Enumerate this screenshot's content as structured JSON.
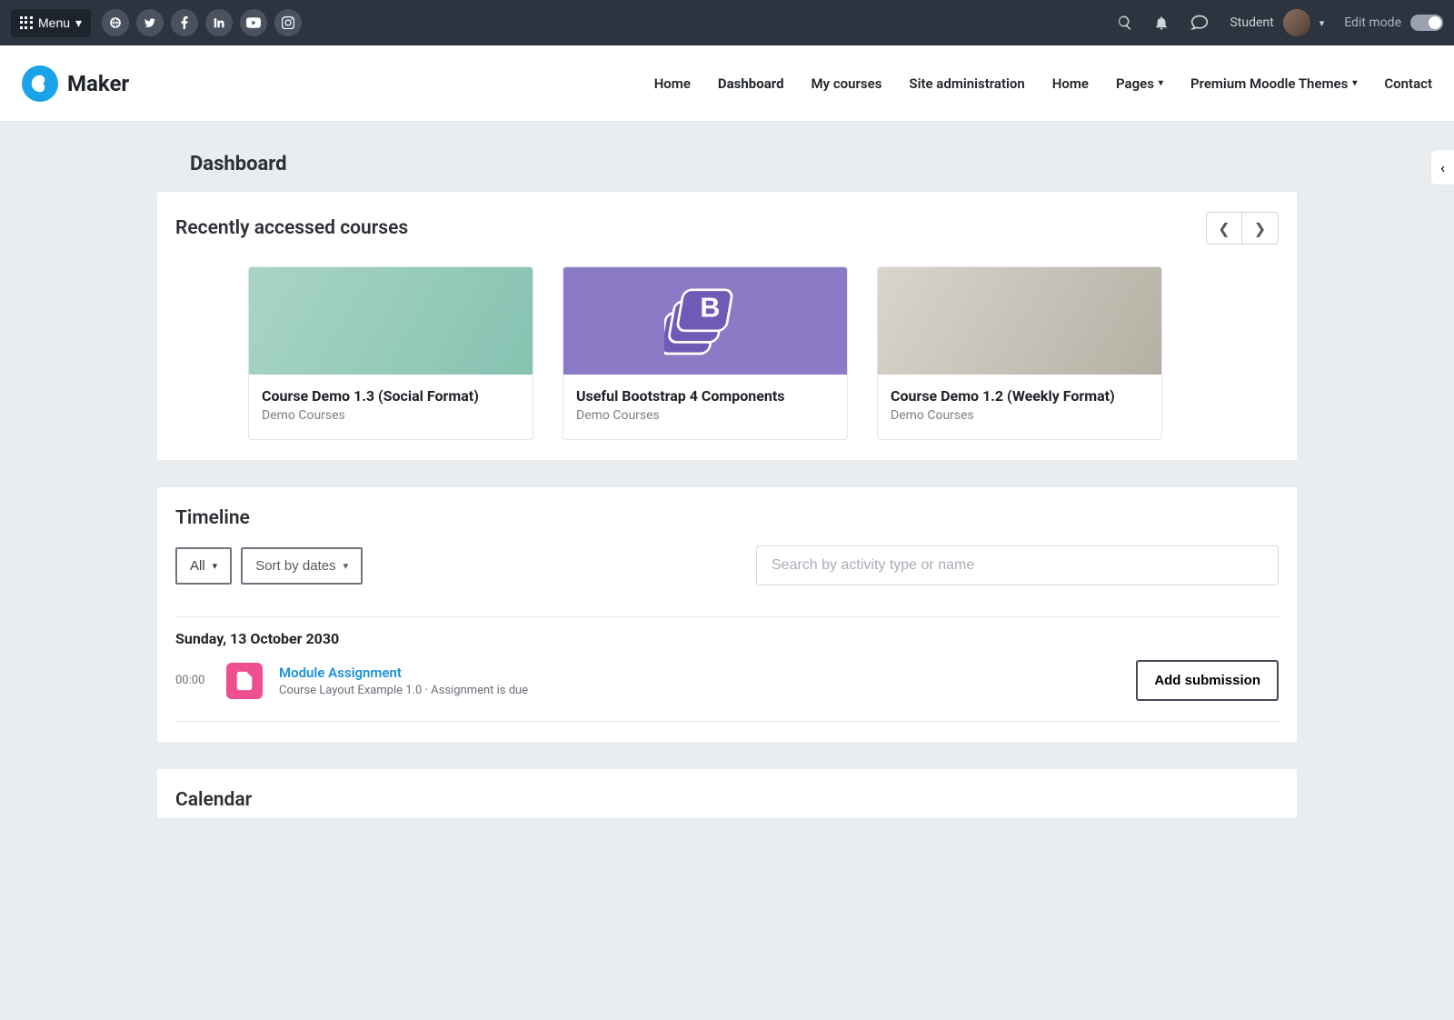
{
  "topbar": {
    "menu_label": "Menu",
    "username": "Student",
    "edit_mode_label": "Edit mode"
  },
  "brand": {
    "name": "Maker"
  },
  "nav": {
    "home": "Home",
    "dashboard": "Dashboard",
    "mycourses": "My courses",
    "siteadmin": "Site administration",
    "home2": "Home",
    "pages": "Pages",
    "themes": "Premium Moodle Themes",
    "contact": "Contact"
  },
  "page": {
    "title": "Dashboard"
  },
  "recent": {
    "title": "Recently accessed courses",
    "courses": [
      {
        "title": "Course Demo 1.3 (Social Format)",
        "category": "Demo Courses"
      },
      {
        "title": "Useful Bootstrap 4 Components",
        "category": "Demo Courses"
      },
      {
        "title": "Course Demo 1.2 (Weekly Format)",
        "category": "Demo Courses"
      }
    ]
  },
  "timeline": {
    "title": "Timeline",
    "filter_all": "All",
    "sort_label": "Sort by dates",
    "search_placeholder": "Search by activity type or name",
    "date_header": "Sunday, 13 October 2030",
    "item": {
      "time": "00:00",
      "title": "Module Assignment",
      "subtitle": "Course Layout Example 1.0 · Assignment is due",
      "action": "Add submission"
    }
  },
  "calendar": {
    "title": "Calendar"
  }
}
